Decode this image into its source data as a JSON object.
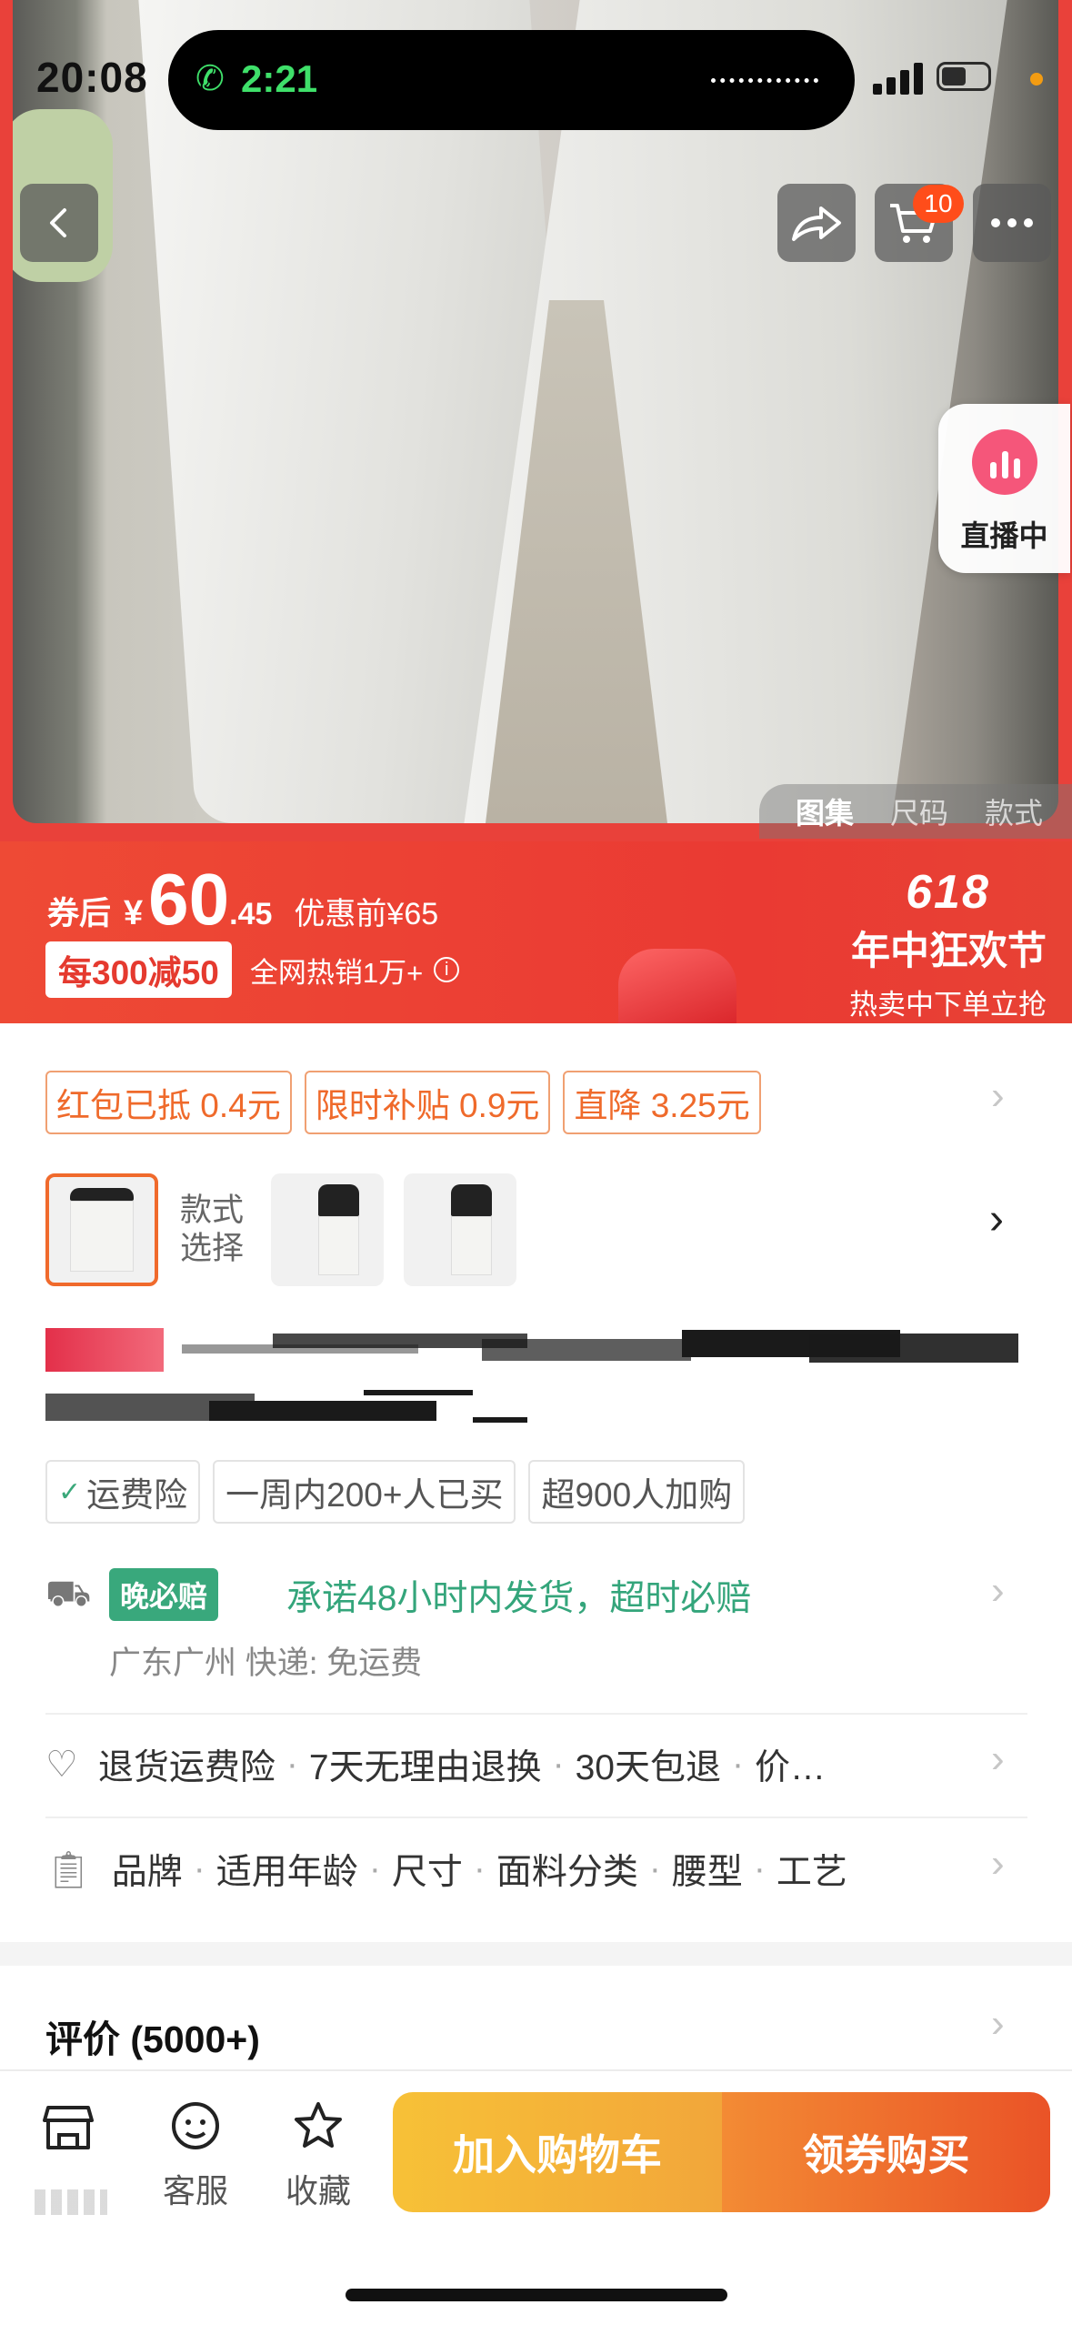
{
  "status_bar": {
    "time": "20:08",
    "call_duration": "2:21"
  },
  "header": {
    "cart_badge": "10"
  },
  "live": {
    "label": "直播中"
  },
  "gallery_tabs": [
    "图集",
    "尺码",
    "款式"
  ],
  "price": {
    "after_coupon_label": "券后",
    "currency": "¥",
    "integer": "60",
    "decimal": ".45",
    "original": "优惠前¥65",
    "promo": "每300减50",
    "hot_sales": "全网热销1万+"
  },
  "festival": {
    "number": "618",
    "name": "年中狂欢节",
    "subtitle": "热卖中下单立抢"
  },
  "benefits": [
    "红包已抵 0.4元",
    "限时补贴 0.9元",
    "直降 3.25元"
  ],
  "style_select": {
    "label_line1": "款式",
    "label_line2": "选择"
  },
  "tags": [
    "运费险",
    "一周内200+人已买",
    "超900人加购"
  ],
  "shipping": {
    "badge": "晚必赔",
    "promise": "承诺48小时内发货，超时必赔",
    "location": "广东广州  快递: 免运费"
  },
  "services": [
    "退货运费险",
    "7天无理由退换",
    "30天包退",
    "价…"
  ],
  "params": [
    "品牌",
    "适用年龄",
    "尺寸",
    "面料分类",
    "腰型",
    "工艺"
  ],
  "review": {
    "label": "评价 (5000+)"
  },
  "bottom_nav": {
    "customer_service": "客服",
    "favorite": "收藏"
  },
  "actions": {
    "add_to_cart": "加入购物车",
    "buy_with_coupon": "领券购买"
  },
  "colors": {
    "accent_red": "#e9413a",
    "orange": "#ef6a2b",
    "green": "#39a87c"
  }
}
